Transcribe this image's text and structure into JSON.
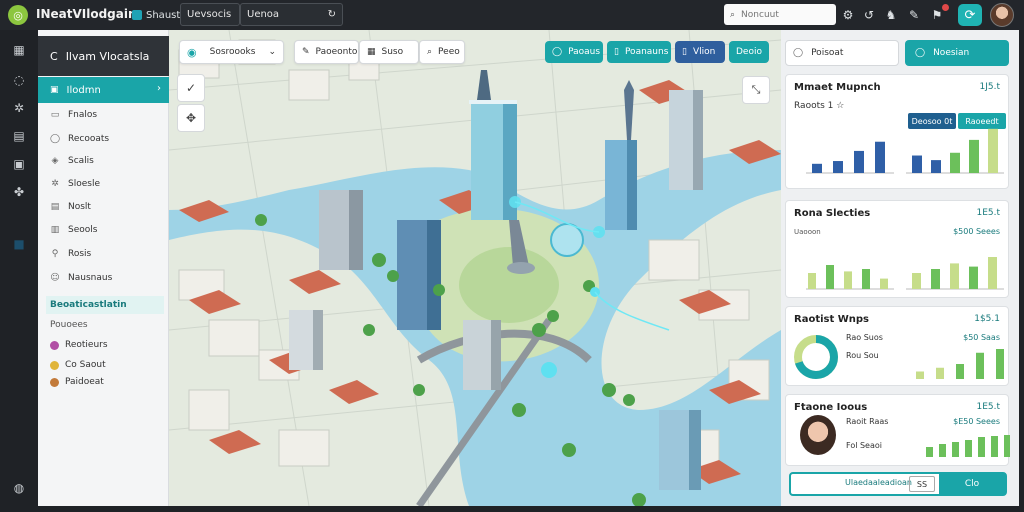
{
  "app": {
    "title": "INeatVIlodgain",
    "logo_icon": "globe-icon"
  },
  "topbar": {
    "item1": "Shaust",
    "field1": "Uevsocis",
    "field2": "Uenoa",
    "search_placeholder": "Noncuut"
  },
  "sidebar": {
    "header_label": "Ilvam Vlocatsla",
    "active_item": "Ilodmn",
    "items": [
      "Fnalos",
      "Recooats",
      "Scalis",
      "Sloesle",
      "Noslt",
      "Seools",
      "Rosis",
      "Nausnaus"
    ],
    "section_label": "Beoaticastlatin",
    "sub_label": "Pouoees",
    "small_items": [
      "Reotieurs",
      "Co Saout",
      "Paidoeat"
    ]
  },
  "map": {
    "toolbar_select": "Sosroooks",
    "toolbar_item2": "Paoeonto",
    "toolbar_item3": "Suso",
    "toolbar_item4": "Peeo",
    "pill1": "Paoaus",
    "pill2": "Poanauns",
    "pill3": "Vlion",
    "pill4": "Deoio"
  },
  "right_panel": {
    "top_input": "Poisoat",
    "top_button": "Noesian",
    "card1": {
      "title": "Mmaet Mupnch",
      "value": "1J5.t",
      "sub": "Raoots 1 ☆",
      "tag1": "Deosoo 0t",
      "tag2": "Raoeedt"
    },
    "card2": {
      "title": "Rona Slecties",
      "value": "1E5.t",
      "sub": "Uaooon",
      "value2": "$500 Seees"
    },
    "card3": {
      "title": "Raotist Wnps",
      "value": "1$5.1",
      "row1_label": "Rao Suos",
      "row1_value": "$50 Saas",
      "row2_label": "Rou Sou"
    },
    "card4": {
      "title": "Ftaone Ioous",
      "value": "1E5.t",
      "row1_label": "Raoit Raas",
      "row1_value": "$E50 Seees",
      "row2_label": "Fol Seaoi"
    },
    "footer_label": "Ulaedaaleadioan",
    "footer_icon": "SS",
    "footer_button": "Clo"
  },
  "chart_data": [
    {
      "type": "bar",
      "series": [
        {
          "values": [
            1,
            1.3,
            2.4,
            3.4
          ]
        },
        {
          "values": [
            1.9,
            1.4,
            2.2,
            3.6,
            4.8
          ]
        }
      ],
      "ylim": [
        0,
        5
      ]
    },
    {
      "type": "bar",
      "series": [
        {
          "values": [
            2,
            3,
            2.2,
            2.5,
            1.3
          ]
        },
        {
          "values": [
            2,
            2.5,
            3.2,
            2.8,
            4
          ]
        }
      ],
      "ylim": [
        0,
        5
      ]
    },
    {
      "type": "pie",
      "values": [
        70,
        30
      ]
    },
    {
      "type": "bar",
      "series": [
        {
          "values": [
            1,
            1.5,
            2,
            3.5,
            4
          ]
        }
      ]
    },
    {
      "type": "bar",
      "series": [
        {
          "values": [
            1,
            1.3,
            1.5,
            1.7,
            2,
            2.1,
            2.2
          ]
        }
      ]
    }
  ],
  "colors": {
    "accent": "#1aa5a8",
    "dark": "#23262b",
    "bar_blue": "#2f5fa7",
    "bar_green": "#6cc05b",
    "bar_lime": "#c6dd8a"
  }
}
